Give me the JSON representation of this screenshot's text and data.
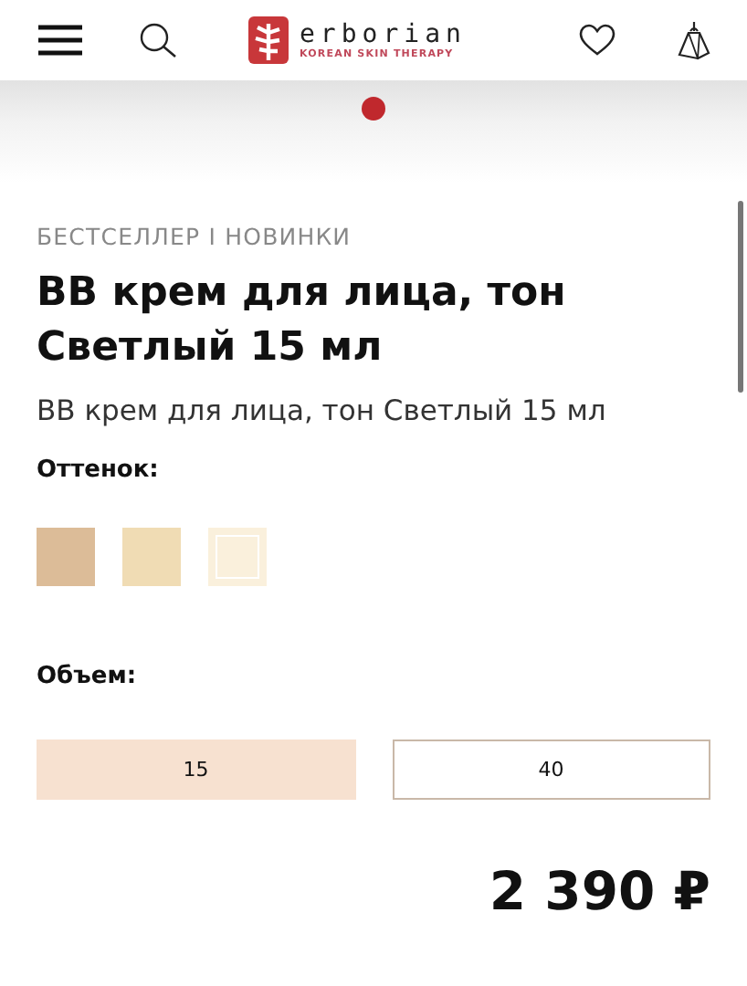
{
  "header": {
    "logo_name": "erborian",
    "logo_tagline": "KOREAN SKIN THERAPY"
  },
  "carousel": {
    "dots": [
      {
        "selected": true
      }
    ]
  },
  "product": {
    "tags": "БЕСТСЕЛЛЕР I НОВИНКИ",
    "title": "BB крем для лица, тон Светлый 15 мл",
    "subtitle": "BB крем для лица, тон Светлый 15 мл"
  },
  "shade": {
    "label": "Оттенок:",
    "swatches": [
      {
        "color": "#dcbc98",
        "selected": false
      },
      {
        "color": "#f0dcb4",
        "selected": false
      },
      {
        "color": "#faf0dc",
        "selected": true
      }
    ]
  },
  "volume": {
    "label": "Объем:",
    "options": [
      {
        "label": "15",
        "selected": true
      },
      {
        "label": "40",
        "selected": false
      }
    ]
  },
  "price": "2 390 ₽"
}
